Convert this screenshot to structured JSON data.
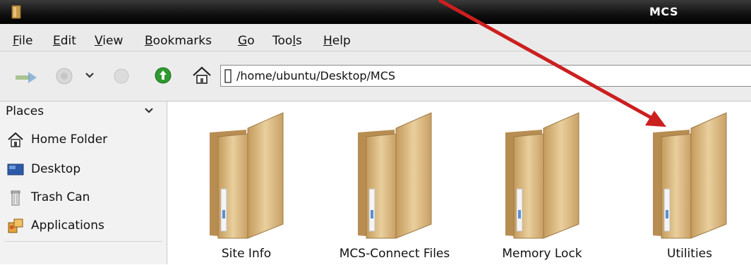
{
  "window": {
    "title": "MCS"
  },
  "menubar": {
    "items": [
      {
        "label": "File",
        "key": "F",
        "rest": "ile"
      },
      {
        "label": "Edit",
        "key": "E",
        "rest": "dit"
      },
      {
        "label": "View",
        "key": "V",
        "rest": "iew"
      },
      {
        "label": "Bookmarks",
        "key": "B",
        "rest": "ookmarks"
      },
      {
        "label": "Go",
        "key": "G",
        "rest": "o"
      },
      {
        "label": "Tools",
        "pre": "Too",
        "key": "l",
        "rest": "s"
      },
      {
        "label": "Help",
        "key": "H",
        "rest": "elp"
      }
    ]
  },
  "toolbar": {
    "location": "/home/ubuntu/Desktop/MCS",
    "icons": [
      "forward-icon",
      "history-icon",
      "chevron-down-icon",
      "stop-icon",
      "reload-icon",
      "home-icon"
    ]
  },
  "sidebar": {
    "header": "Places",
    "items": [
      {
        "label": "Home Folder",
        "icon": "home-icon"
      },
      {
        "label": "Desktop",
        "icon": "desktop-icon"
      },
      {
        "label": "Trash Can",
        "icon": "trash-icon"
      },
      {
        "label": "Applications",
        "icon": "applications-icon"
      }
    ]
  },
  "main": {
    "folders": [
      {
        "name": "Site Info"
      },
      {
        "name": "MCS-Connect Files"
      },
      {
        "name": "Memory Lock"
      },
      {
        "name": "Utilities"
      }
    ]
  },
  "annotation": {
    "arrow_color": "#cc1f1f",
    "points_to": "Utilities"
  }
}
